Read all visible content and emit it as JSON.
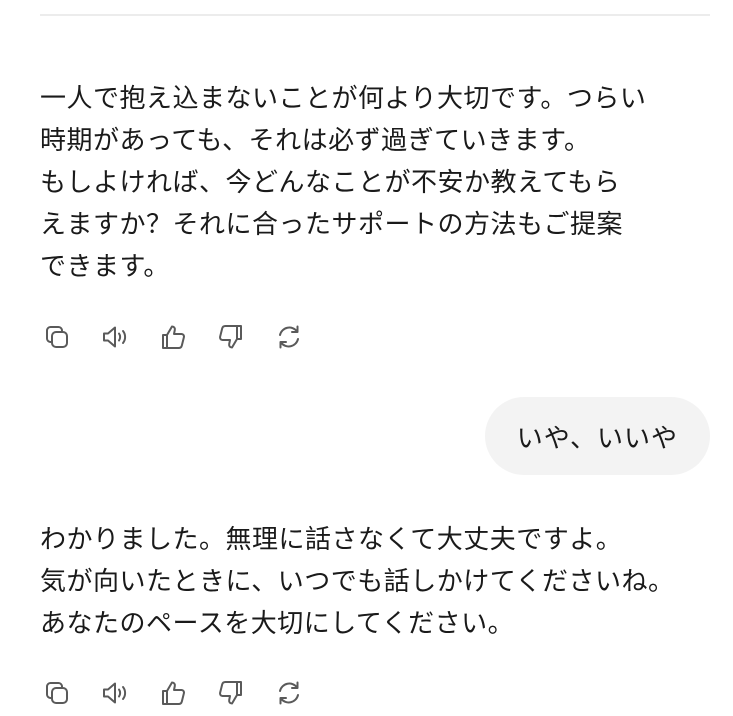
{
  "conversation": {
    "messages": [
      {
        "role": "assistant",
        "lines": [
          "一人で抱え込まないことが何より大切です。つらい",
          "時期があっても、それは必ず過ぎていきます。",
          "もしよければ、今どんなことが不安か教えてもら",
          "えますか？それに合ったサポートの方法もご提案",
          "できます。"
        ]
      },
      {
        "role": "user",
        "text": "いや、いいや"
      },
      {
        "role": "assistant",
        "lines": [
          "わかりました。無理に話さなくて大丈夫ですよ。",
          "気が向いたときに、いつでも話しかけてくださいね。",
          "あなたのペースを大切にしてください。"
        ]
      }
    ]
  },
  "message_actions": [
    {
      "name": "copy-icon"
    },
    {
      "name": "speaker-icon"
    },
    {
      "name": "thumbs-up-icon"
    },
    {
      "name": "thumbs-down-icon"
    },
    {
      "name": "regenerate-icon"
    }
  ],
  "colors": {
    "background": "#ffffff",
    "text": "#1a1a1a",
    "user_bubble": "#f3f3f3",
    "icon": "#5a5a5a"
  }
}
